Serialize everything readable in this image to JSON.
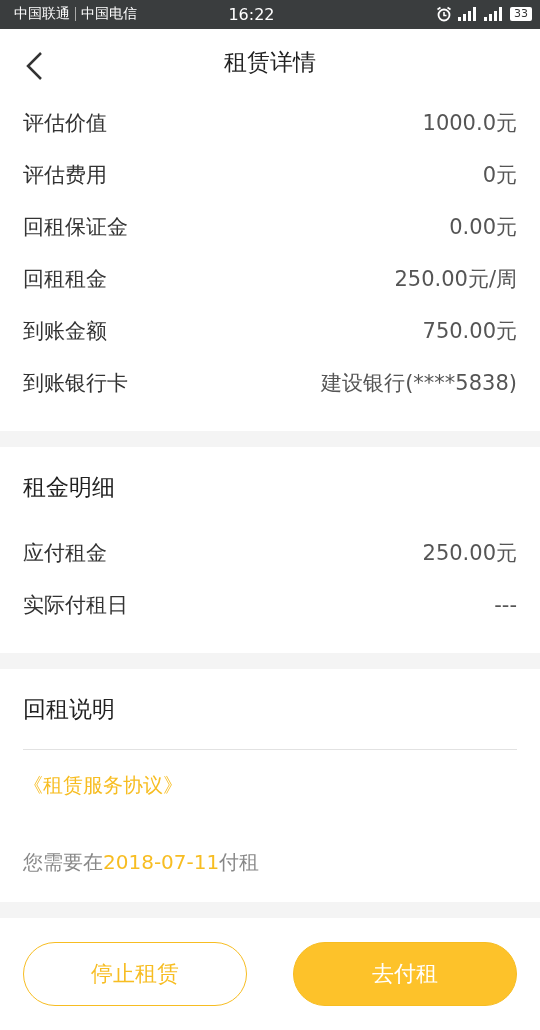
{
  "status_bar": {
    "carriers": [
      "中国联通",
      "中国电信"
    ],
    "time": "16:22",
    "battery": "33"
  },
  "header": {
    "title": "租赁详情"
  },
  "summary": {
    "rows": [
      {
        "label": "评估价值",
        "value": "1000.0元"
      },
      {
        "label": "评估费用",
        "value": "0元"
      },
      {
        "label": "回租保证金",
        "value": "0.00元"
      },
      {
        "label": "回租租金",
        "value": "250.00元/周"
      },
      {
        "label": "到账金额",
        "value": "750.00元"
      },
      {
        "label": "到账银行卡",
        "value": "建设银行(****5838)"
      }
    ]
  },
  "rent_detail": {
    "title": "租金明细",
    "rows": [
      {
        "label": "应付租金",
        "value": "250.00元"
      },
      {
        "label": "实际付租日",
        "value": "---"
      }
    ]
  },
  "notes": {
    "title": "回租说明",
    "link": "《租赁服务协议》",
    "message_before": "您需要在",
    "date": "2018-07-11",
    "message_after": "付租"
  },
  "buttons": [
    {
      "label": "停止租赁",
      "kind": "outline"
    },
    {
      "label": "去付租",
      "kind": "filled"
    }
  ]
}
